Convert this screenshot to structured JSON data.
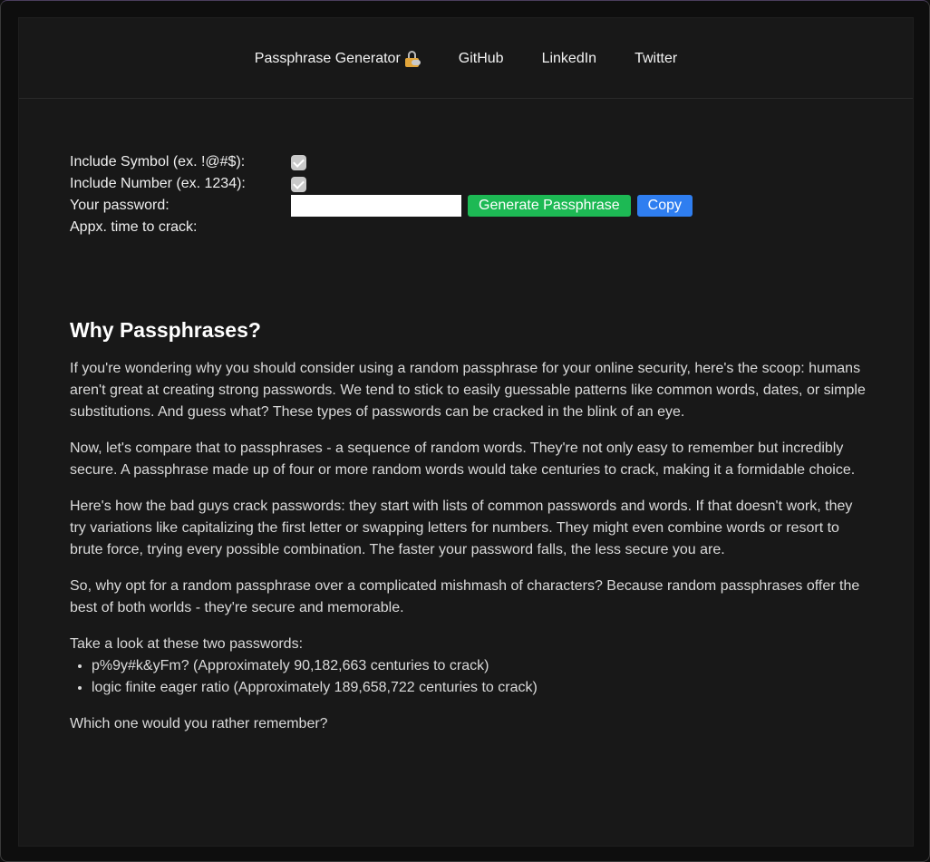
{
  "nav": {
    "items": [
      {
        "label": "Passphrase Generator",
        "icon": "lock-with-key-icon"
      },
      {
        "label": "GitHub"
      },
      {
        "label": "LinkedIn"
      },
      {
        "label": "Twitter"
      }
    ]
  },
  "form": {
    "symbol_label": "Include Symbol (ex. !@#$):",
    "symbol_checked": true,
    "number_label": "Include Number (ex. 1234):",
    "number_checked": true,
    "password_label": "Your password:",
    "password_value": "",
    "generate_label": "Generate Passphrase",
    "copy_label": "Copy",
    "crack_label": "Appx. time to crack:",
    "crack_value": ""
  },
  "article": {
    "heading": "Why Passphrases?",
    "paragraphs": [
      "If you're wondering why you should consider using a random passphrase for your online security, here's the scoop: humans aren't great at creating strong passwords. We tend to stick to easily guessable patterns like common words, dates, or simple substitutions. And guess what? These types of passwords can be cracked in the blink of an eye.",
      "Now, let's compare that to passphrases - a sequence of random words. They're not only easy to remember but incredibly secure. A passphrase made up of four or more random words would take centuries to crack, making it a formidable choice.",
      "Here's how the bad guys crack passwords: they start with lists of common passwords and words. If that doesn't work, they try variations like capitalizing the first letter or swapping letters for numbers. They might even combine words or resort to brute force, trying every possible combination. The faster your password falls, the less secure you are.",
      "So, why opt for a random passphrase over a complicated mishmash of characters? Because random passphrases offer the best of both worlds - they're secure and memorable."
    ],
    "compare_intro": "Take a look at these two passwords:",
    "examples": [
      "p%9y#k&yFm? (Approximately 90,182,663 centuries to crack)",
      "logic finite eager ratio (Approximately 189,658,722 centuries to crack)"
    ],
    "closing": "Which one would you rather remember?"
  },
  "colors": {
    "background": "#181818",
    "generate_button": "#1db954",
    "copy_button": "#2f7ef0"
  }
}
